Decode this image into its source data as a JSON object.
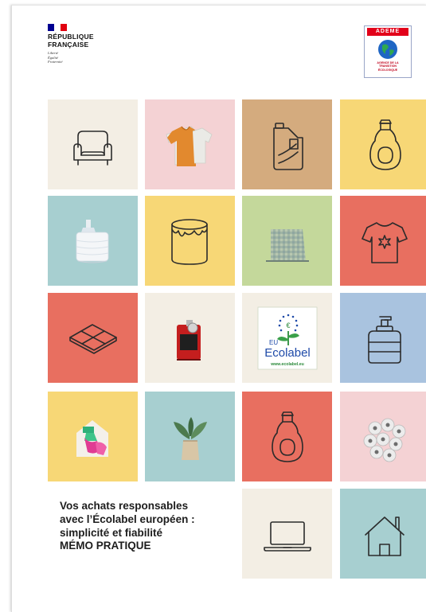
{
  "header": {
    "republic_name_line1": "RÉPUBLIQUE",
    "republic_name_line2": "FRANÇAISE",
    "motto": [
      "Liberté",
      "Égalité",
      "Fraternité"
    ],
    "ademe_title": "ADEME",
    "ademe_subtitle": [
      "AGENCE DE LA",
      "TRANSITION",
      "ÉCOLOGIQUE"
    ]
  },
  "tiles": [
    {
      "icon": "armchair-icon",
      "bg": "#f3eee4"
    },
    {
      "icon": "clothing-photo",
      "bg": "#f4d2d4"
    },
    {
      "icon": "jerrycan-icon",
      "bg": "#d4ab7e"
    },
    {
      "icon": "detergent-bottle-icon",
      "bg": "#f7d776"
    },
    {
      "icon": "wipes-photo",
      "bg": "#a7cfd0"
    },
    {
      "icon": "paint-pot-icon",
      "bg": "#f7d776"
    },
    {
      "icon": "fabric-photo",
      "bg": "#c4d89b"
    },
    {
      "icon": "tshirt-icon",
      "bg": "#e86f60"
    },
    {
      "icon": "tiles-icon",
      "bg": "#e86f60"
    },
    {
      "icon": "lubricant-photo",
      "bg": "#f3eee4"
    },
    {
      "icon": "eu-ecolabel-logo",
      "bg": "#f3eee4"
    },
    {
      "icon": "soap-dispenser-icon",
      "bg": "#a9c3df"
    },
    {
      "icon": "cleaning-photo",
      "bg": "#f7d776"
    },
    {
      "icon": "plant-photo",
      "bg": "#a7cfd0"
    },
    {
      "icon": "detergent-bottle-icon",
      "bg": "#e86f60"
    },
    {
      "icon": "toilet-paper-photo",
      "bg": "#f4d2d4"
    },
    {
      "icon": "laptop-icon",
      "bg": "#f3eee4"
    },
    {
      "icon": "house-icon",
      "bg": "#a7cfd0"
    }
  ],
  "ecolabel": {
    "eu": "EU",
    "name": "Ecolabel",
    "url": "www.ecolabel.eu"
  },
  "title": {
    "line1": "Vos achats responsables",
    "line2": "avec l’Écolabel européen :",
    "line3": "simplicité et fiabilité",
    "line4": "MÉMO PRATIQUE"
  },
  "colors": {
    "cream": "#f3eee4",
    "pink": "#f4d2d4",
    "tan": "#d4ab7e",
    "yellow": "#f7d776",
    "teal": "#a7cfd0",
    "green": "#c4d89b",
    "coral": "#e86f60",
    "blue": "#a9c3df",
    "icon_stroke": "#2b2b2b",
    "marianne_blue": "#000091",
    "marianne_red": "#e1000f"
  }
}
